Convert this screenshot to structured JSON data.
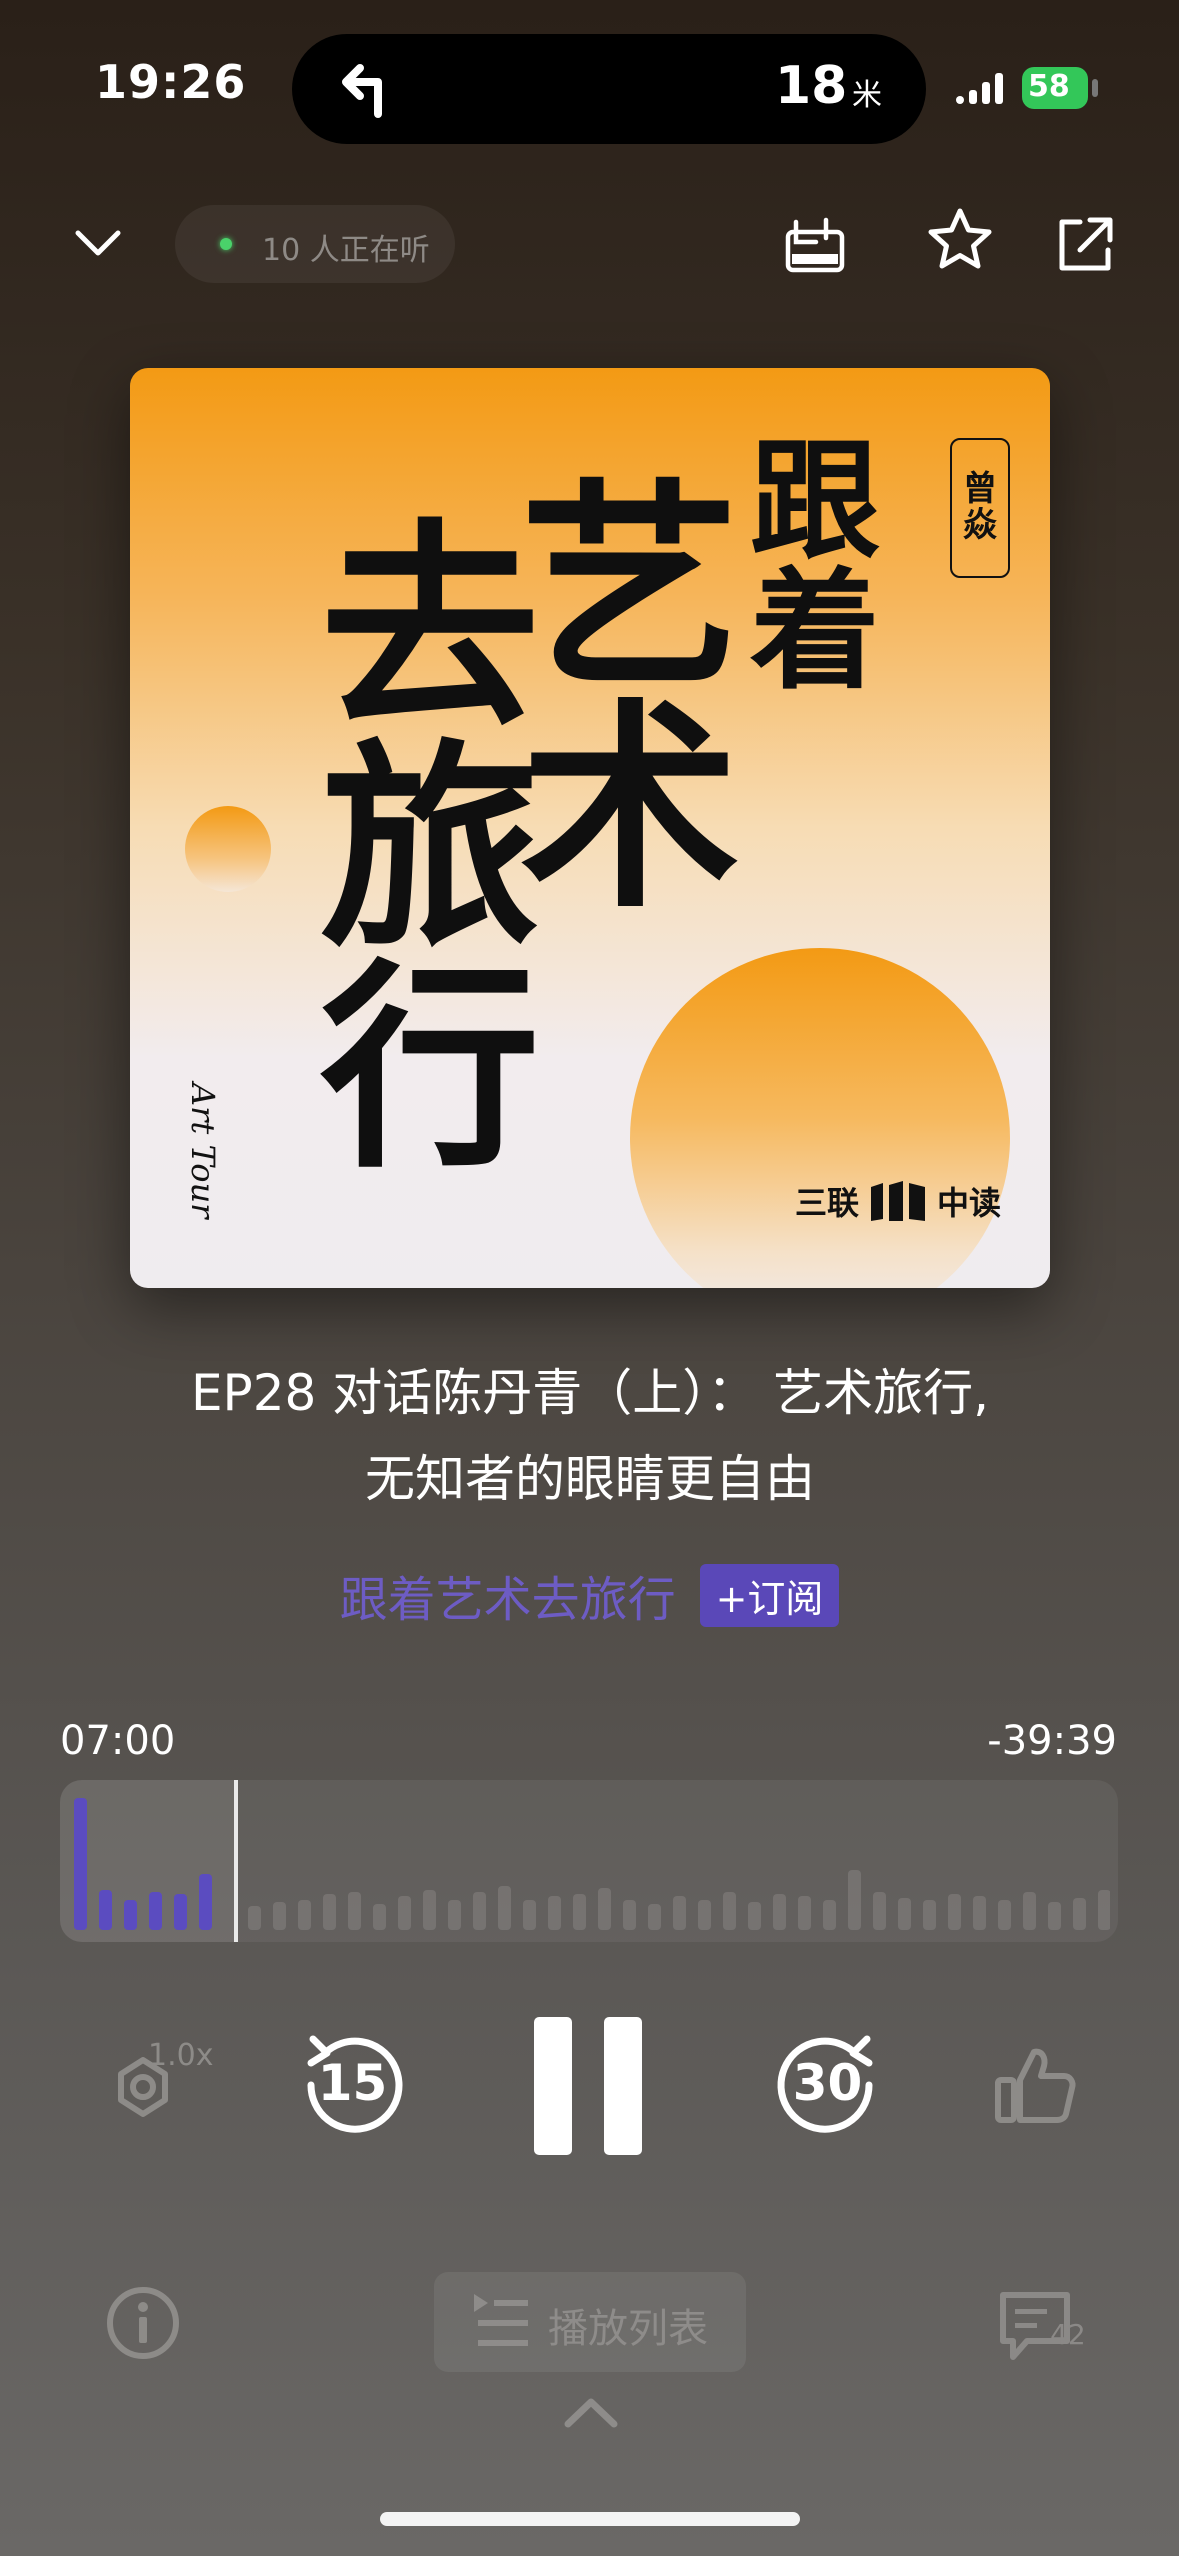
{
  "status_bar": {
    "time": "19:26",
    "nav_distance": "18",
    "nav_unit": "米",
    "battery_level": "58",
    "battery_color": "#33c759"
  },
  "header": {
    "collapse_icon": "chevron-down-icon",
    "listeners_text": "10 人正在听",
    "download_icon": "download-icon",
    "favorite_icon": "star-icon",
    "share_icon": "share-icon"
  },
  "cover": {
    "title_chars": [
      "跟",
      "着",
      "艺",
      "术",
      "去",
      "旅",
      "行"
    ],
    "seal_text": [
      "曾",
      "焱"
    ],
    "english_title": "Art Tour",
    "publisher_left": "三联",
    "publisher_right": "中读"
  },
  "episode": {
    "title_line1": "EP28 对话陈丹青（上）：  艺术旅行,",
    "title_line2": "无知者的眼睛更自由",
    "podcast_name": "跟着艺术去旅行",
    "subscribe_label": "+订阅",
    "accent_color": "#6d5cc4"
  },
  "progress": {
    "elapsed": "07:00",
    "remaining": "-39:39",
    "played_fraction": 0.15
  },
  "controls": {
    "speed_label": "1.0x",
    "rewind_seconds": "15",
    "forward_seconds": "30",
    "pause_icon": "pause-icon",
    "like_icon": "thumbs-up-icon"
  },
  "bottom": {
    "info_icon": "info-icon",
    "playlist_label": "播放列表",
    "comments_count": "42",
    "expand_icon": "chevron-up-icon"
  }
}
